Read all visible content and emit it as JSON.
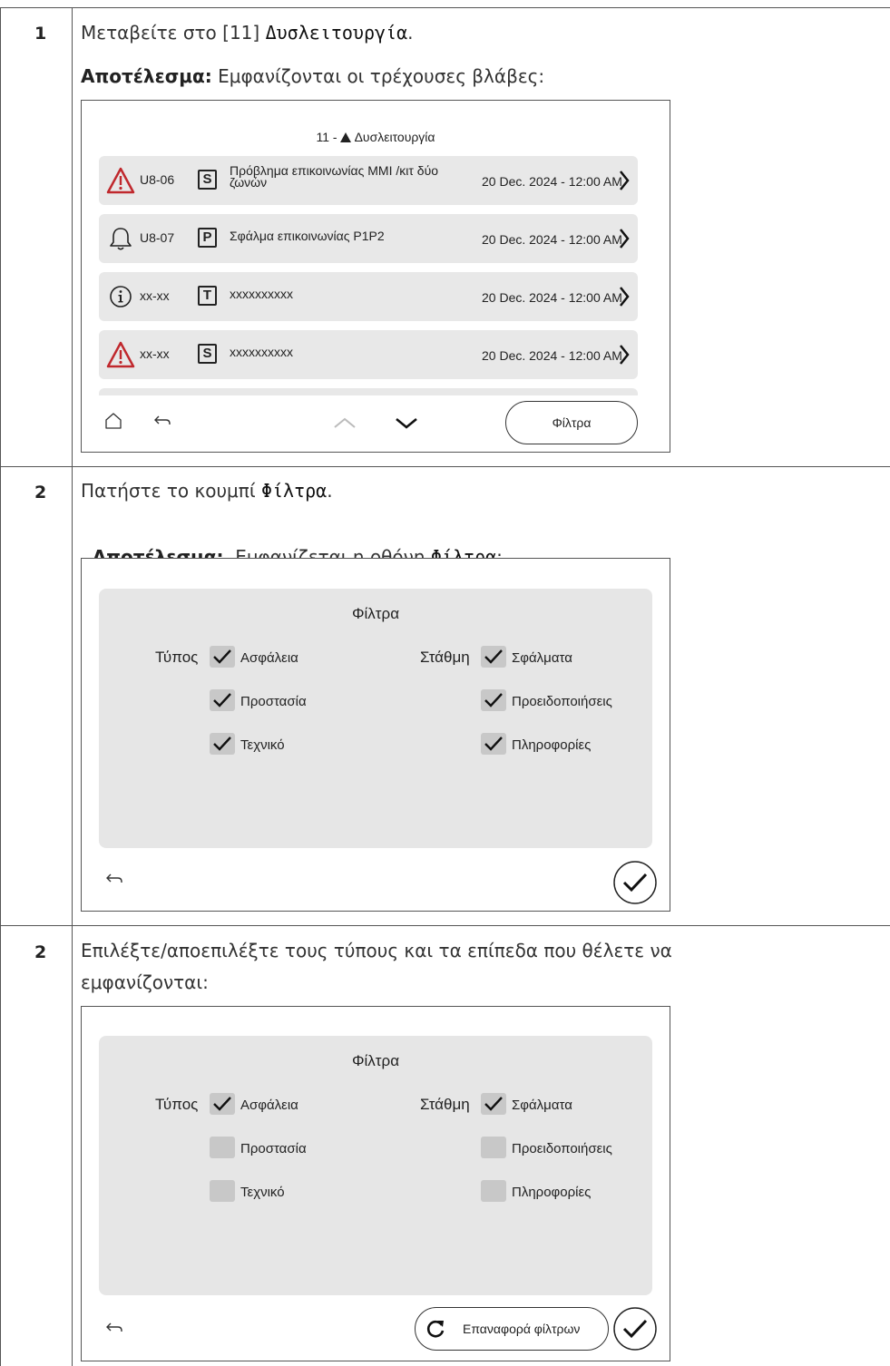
{
  "steps": [
    {
      "number": "1",
      "instruction_prefix": "Μεταβείτε στο [11] ",
      "instruction_mono": "Δυσλειτουργία",
      "instruction_suffix": ".",
      "result_label": "Αποτέλεσμα:",
      "result_text": " Εμφανίζονται οι τρέχουσες βλάβες:",
      "screen": {
        "title_prefix": "11 - ",
        "title_text": " Δυσλειτουργία",
        "rows": [
          {
            "icon": "warning-triangle-icon",
            "code": "U8-06",
            "letter": "S",
            "desc": "Πρόβλημα επικοινωνίας MMI /κιτ δύο ζωνών",
            "date": "20 Dec. 2024 - 12:00 AM"
          },
          {
            "icon": "bell-icon",
            "code": "U8-07",
            "letter": "P",
            "desc": "Σφάλμα επικοινωνίας P1P2",
            "date": "20 Dec. 2024 - 12:00 AM"
          },
          {
            "icon": "info-circle-icon",
            "code": "xx-xx",
            "letter": "T",
            "desc": "xxxxxxxxxx",
            "date": "20 Dec. 2024 - 12:00 AM"
          },
          {
            "icon": "warning-triangle-icon",
            "code": "xx-xx",
            "letter": "S",
            "desc": "xxxxxxxxxx",
            "date": "20 Dec. 2024 - 12:00 AM"
          }
        ],
        "filter_button": "Φίλτρα"
      }
    },
    {
      "number": "2",
      "instruction_prefix": "Πατήστε το κουμπί ",
      "instruction_mono": "Φίλτρα",
      "instruction_suffix": ".",
      "result_label": "Αποτέλεσμα:",
      "result_text_prefix": "  Εμφανίζεται η οθόνη ",
      "result_mono": "Φίλτρα",
      "result_suffix": ":",
      "screen": {
        "title": "Φίλτρα",
        "type_label": "Τύπος",
        "level_label": "Στάθμη",
        "type_options": [
          {
            "label": "Ασφάλεια",
            "checked": true
          },
          {
            "label": "Προστασία",
            "checked": true
          },
          {
            "label": "Τεχνικό",
            "checked": true
          }
        ],
        "level_options": [
          {
            "label": "Σφάλματα",
            "checked": true
          },
          {
            "label": "Προειδοποιήσεις",
            "checked": true
          },
          {
            "label": "Πληροφορίες",
            "checked": true
          }
        ]
      }
    },
    {
      "number": "2",
      "instruction_line1": "Επιλέξτε/αποεπιλέξτε τους τύπους και τα επίπεδα που θέλετε να",
      "instruction_line2": "εμφανίζονται:",
      "screen": {
        "title": "Φίλτρα",
        "type_label": "Τύπος",
        "level_label": "Στάθμη",
        "type_options": [
          {
            "label": "Ασφάλεια",
            "checked": true
          },
          {
            "label": "Προστασία",
            "checked": false
          },
          {
            "label": "Τεχνικό",
            "checked": false
          }
        ],
        "level_options": [
          {
            "label": "Σφάλματα",
            "checked": true
          },
          {
            "label": "Προειδοποιήσεις",
            "checked": false
          },
          {
            "label": "Πληροφορίες",
            "checked": false
          }
        ],
        "reset_button": "Επαναφορά φίλτρων"
      }
    }
  ]
}
